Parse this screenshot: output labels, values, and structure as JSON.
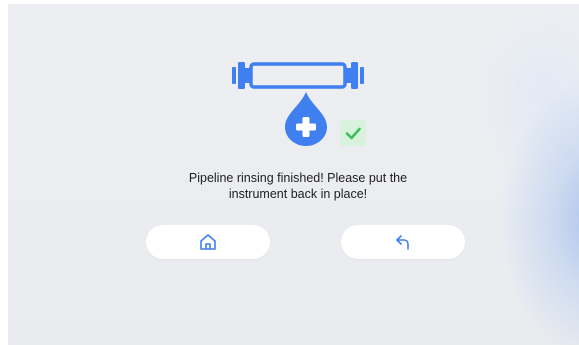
{
  "dialog": {
    "message_line1": "Pipeline rinsing finished! Please put the",
    "message_line2": "instrument back in place!"
  },
  "icons": {
    "illustration": "pipe-with-water-drop-icon",
    "status": "check-icon",
    "home_button": "home-icon",
    "back_button": "return-arrow-icon"
  },
  "colors": {
    "accent_blue": "#3f7ff0",
    "success_green": "#3cc05a",
    "success_bg": "#d9f2dd",
    "button_bg": "#ffffff"
  }
}
